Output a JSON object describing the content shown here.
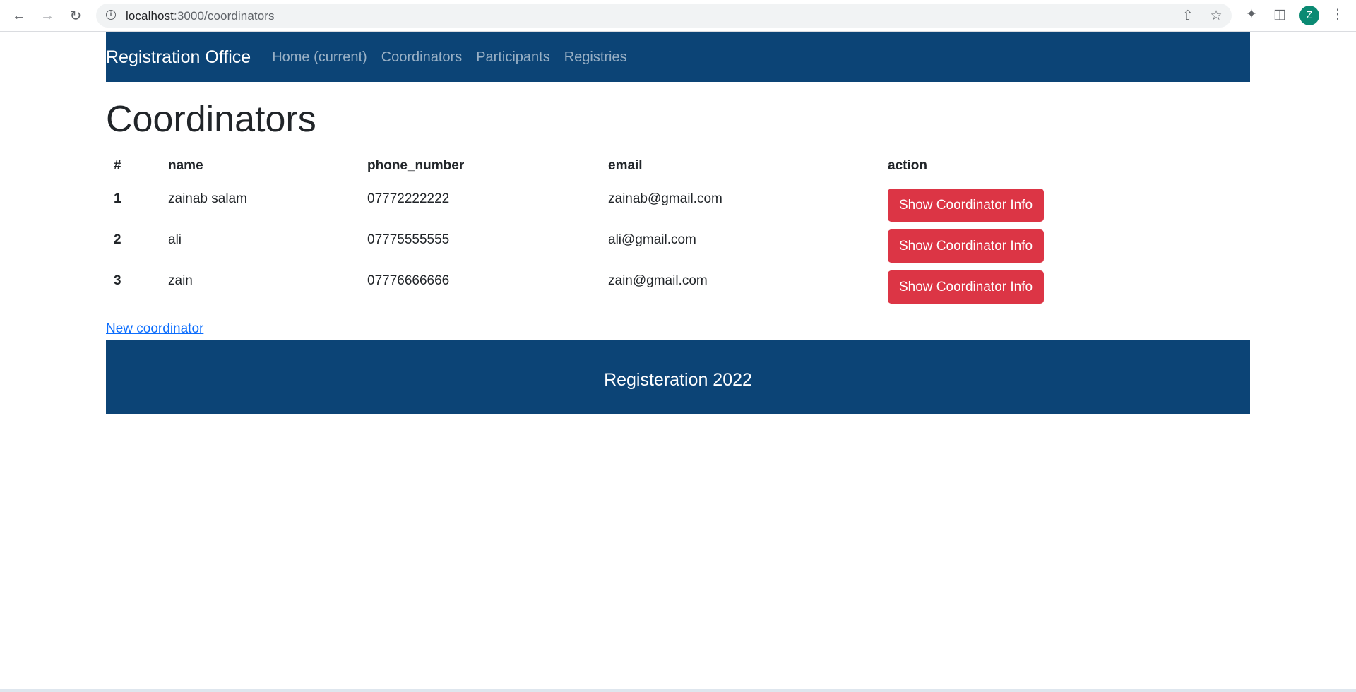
{
  "browser": {
    "url_host": "localhost",
    "url_path": ":3000/coordinators",
    "avatar_letter": "Z",
    "avatar_color": "#0b8a73"
  },
  "navbar": {
    "brand": "Registration Office",
    "links": [
      "Home (current)",
      "Coordinators",
      "Participants",
      "Registries"
    ],
    "background": "#0c4476"
  },
  "page": {
    "title": "Coordinators"
  },
  "table": {
    "headers": [
      "#",
      "name",
      "phone_number",
      "email",
      "action"
    ],
    "rows": [
      {
        "index": "1",
        "name": "zainab salam",
        "phone": "07772222222",
        "email": "zainab@gmail.com",
        "action": "Show Coordinator Info"
      },
      {
        "index": "2",
        "name": "ali",
        "phone": "07775555555",
        "email": "ali@gmail.com",
        "action": "Show Coordinator Info"
      },
      {
        "index": "3",
        "name": "zain",
        "phone": "07776666666",
        "email": "zain@gmail.com",
        "action": "Show Coordinator Info"
      }
    ]
  },
  "new_link": "New coordinator",
  "footer": {
    "text": "Registeration 2022"
  },
  "colors": {
    "danger": "#dc3545",
    "link": "#0d6efd"
  }
}
